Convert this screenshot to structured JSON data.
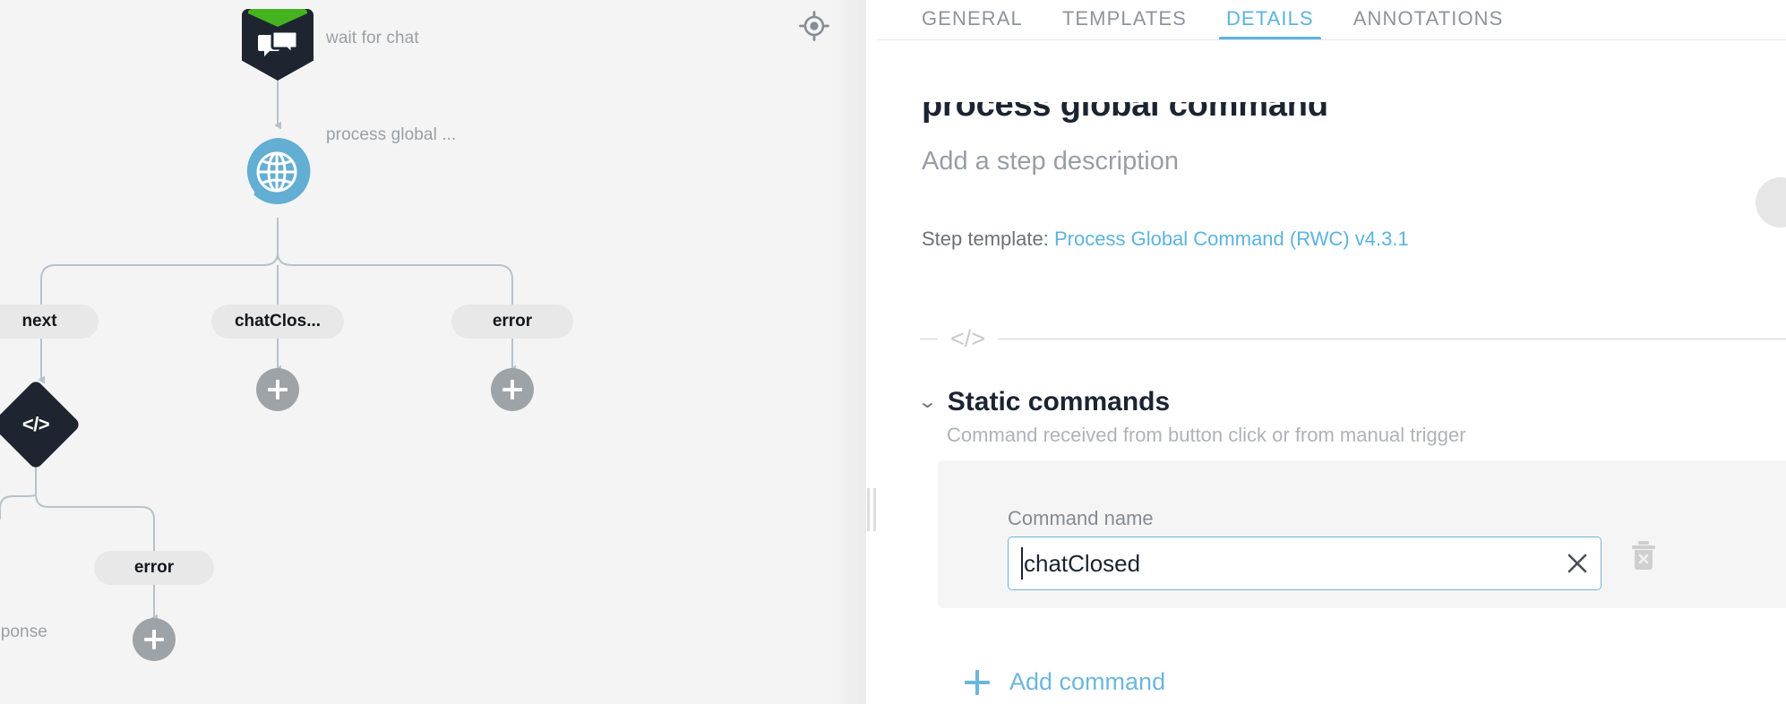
{
  "flow": {
    "nodes": [
      {
        "id": "start",
        "label": "wait for chat",
        "icon": "chat-bubbles-icon",
        "type": "trigger"
      },
      {
        "id": "global",
        "label": "process global ...",
        "icon": "globe-bubble-icon",
        "type": "step"
      },
      {
        "id": "code",
        "label": "",
        "icon": "code-icon",
        "type": "script"
      }
    ],
    "branch_pills": [
      {
        "id": "next",
        "label": "next"
      },
      {
        "id": "chatclosed",
        "label": "chatClos..."
      },
      {
        "id": "error",
        "label": "error"
      },
      {
        "id": "error2",
        "label": "error"
      }
    ],
    "stray_label": "response",
    "add_buttons": [
      {
        "id": "add-chatclosed"
      },
      {
        "id": "add-error"
      },
      {
        "id": "add-error2"
      }
    ],
    "recenter_icon": "crosshair-icon"
  },
  "panel": {
    "tabs": [
      {
        "id": "general",
        "label": "GENERAL",
        "active": false
      },
      {
        "id": "templates",
        "label": "TEMPLATES",
        "active": false
      },
      {
        "id": "details",
        "label": "DETAILS",
        "active": true
      },
      {
        "id": "annotations",
        "label": "ANNOTATIONS",
        "active": false
      }
    ],
    "step_title": "process global command",
    "step_description": "Add a step description",
    "step_template_prefix": "Step template:",
    "step_template_name": "Process Global Command (RWC) v4.3.1",
    "divider_glyph": "</>",
    "section": {
      "chevron": "⌄",
      "title": "Static commands",
      "subtitle": "Command received from button click or from manual trigger"
    },
    "command": {
      "label": "Command name",
      "value": "chatClosed",
      "placeholder": "Command name",
      "clear_icon": "close-icon",
      "delete_icon": "trash-icon"
    },
    "add_command_label": "Add command"
  },
  "colors": {
    "accent": "#5bb3e0",
    "input_border": "#6cb6dd",
    "node_dark": "#1e2530",
    "node_green": "#44b31f",
    "node_blue": "#63aed3",
    "canvas_bg": "#f4f4f4",
    "pill_bg": "#e8e8e8",
    "plus_btn": "#9ea3a8"
  }
}
